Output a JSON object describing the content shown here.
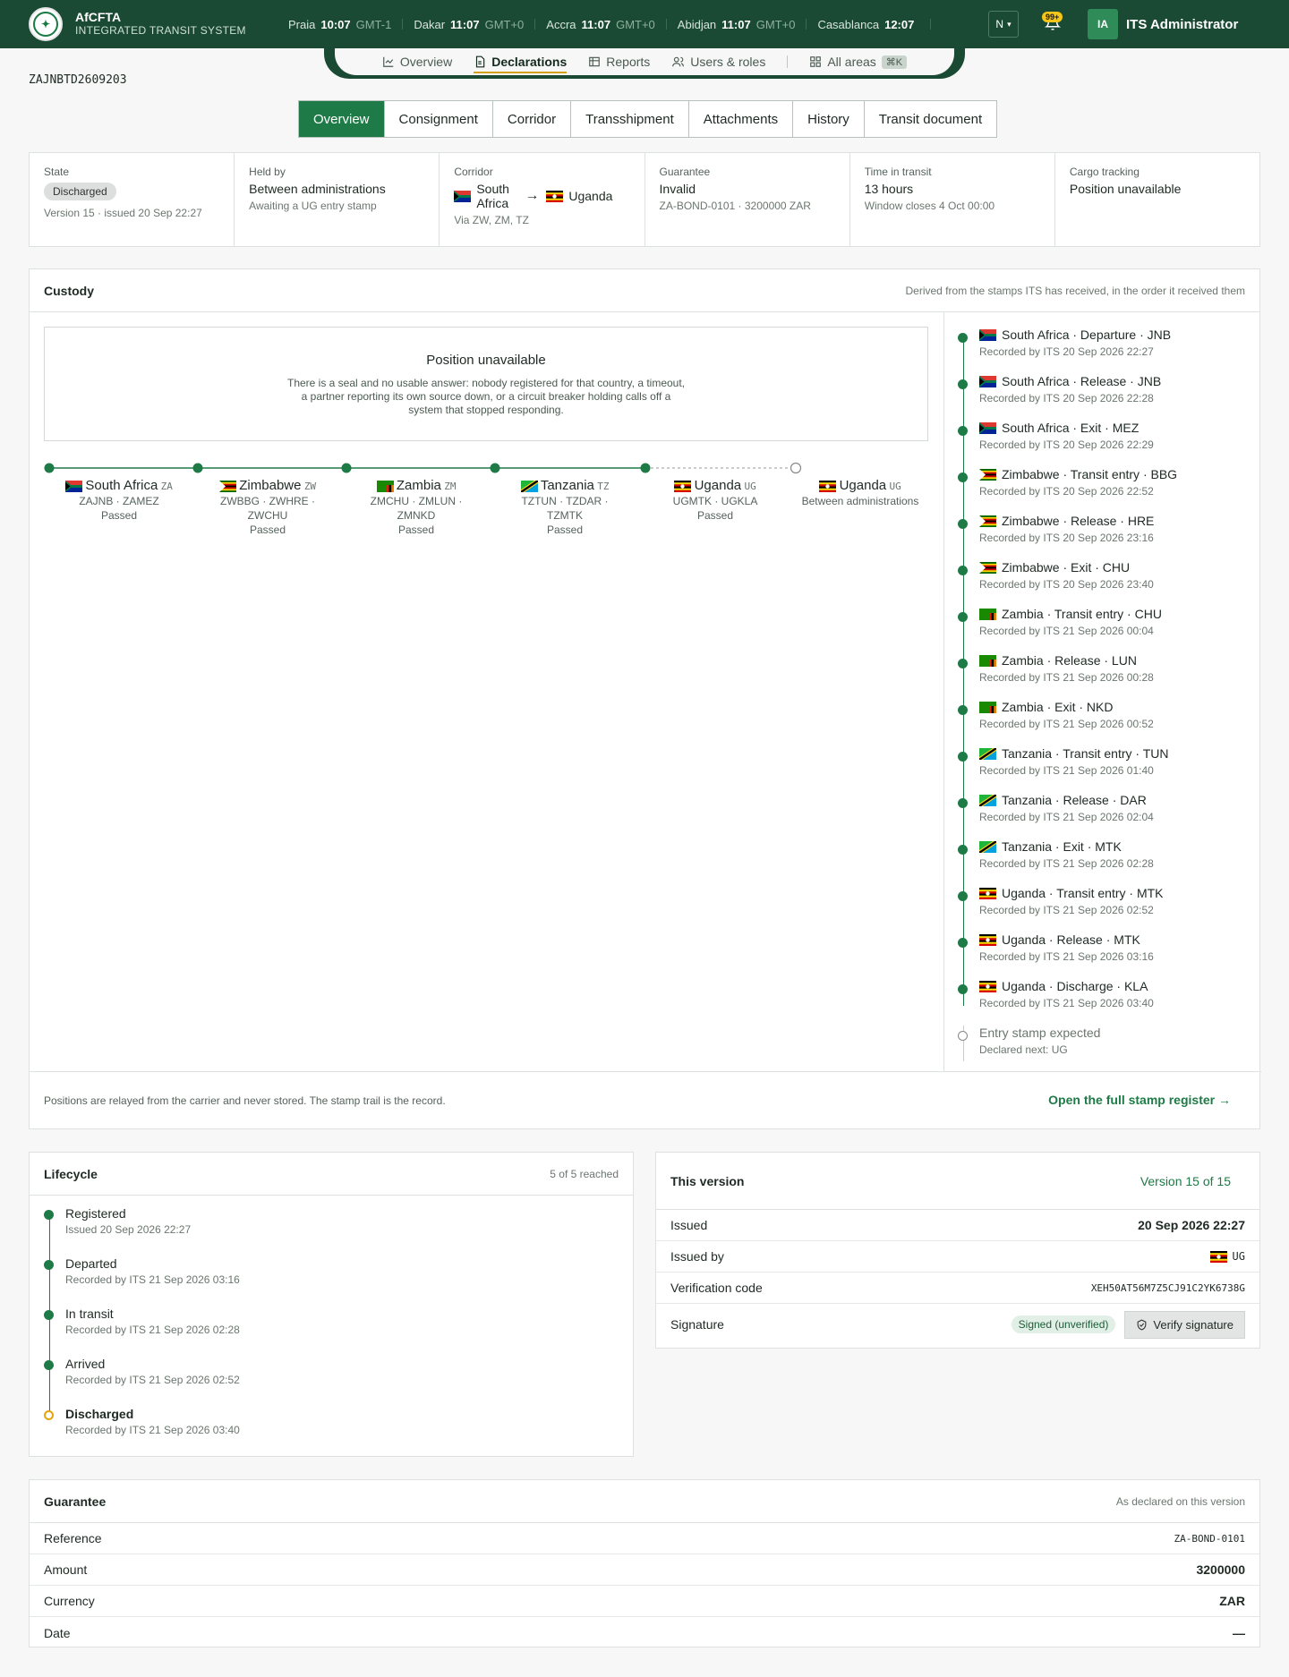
{
  "header": {
    "brand_name": "AfCFTA",
    "brand_sub": "INTEGRATED TRANSIT SYSTEM",
    "clocks": [
      {
        "city": "Praia",
        "time": "10:07",
        "gmt": "GMT-1"
      },
      {
        "city": "Dakar",
        "time": "11:07",
        "gmt": "GMT+0"
      },
      {
        "city": "Accra",
        "time": "11:07",
        "gmt": "GMT+0"
      },
      {
        "city": "Abidjan",
        "time": "11:07",
        "gmt": "GMT+0"
      },
      {
        "city": "Casablanca",
        "time": "12:07",
        "gmt": ""
      }
    ],
    "lang": "N",
    "notifications": "99+",
    "avatar_initials": "IA",
    "user_name": "ITS Administrator"
  },
  "nav": {
    "overview": "Overview",
    "declarations": "Declarations",
    "reports": "Reports",
    "users": "Users & roles",
    "all_areas": "All areas",
    "shortcut": "⌘K"
  },
  "reference": "ZAJNBTD2609203",
  "tabs": [
    "Overview",
    "Consignment",
    "Corridor",
    "Transshipment",
    "Attachments",
    "History",
    "Transit document"
  ],
  "summary": {
    "state_label": "State",
    "state": "Discharged",
    "state_sub": "Version 15 · issued 20 Sep 22:27",
    "held_label": "Held by",
    "held": "Between administrations",
    "held_sub": "Awaiting a UG entry stamp",
    "corridor_label": "Corridor",
    "corridor_from": "South Africa",
    "corridor_to": "Uganda",
    "corridor_sub": "Via ZW, ZM, TZ",
    "guarantee_label": "Guarantee",
    "guarantee": "Invalid",
    "guarantee_sub": "ZA-BOND-0101 · 3200000 ZAR",
    "time_label": "Time in transit",
    "time": "13 hours",
    "time_sub": "Window closes 4 Oct 00:00",
    "cargo_label": "Cargo tracking",
    "cargo": "Position unavailable"
  },
  "custody": {
    "title": "Custody",
    "note": "Derived from the stamps ITS has received, in the order it received them",
    "pos_title": "Position unavailable",
    "pos_desc": "There is a seal and no usable answer: nobody registered for that country, a timeout, a partner reporting its own source down, or a circuit breaker holding calls off a system that stopped responding.",
    "stops": [
      {
        "name": "South Africa",
        "code": "ZA",
        "offices": "ZAJNB · ZAMEZ",
        "status": "Passed"
      },
      {
        "name": "Zimbabwe",
        "code": "ZW",
        "offices": "ZWBBG · ZWHRE · ZWCHU",
        "status": "Passed"
      },
      {
        "name": "Zambia",
        "code": "ZM",
        "offices": "ZMCHU · ZMLUN · ZMNKD",
        "status": "Passed"
      },
      {
        "name": "Tanzania",
        "code": "TZ",
        "offices": "TZTUN · TZDAR · TZMTK",
        "status": "Passed"
      },
      {
        "name": "Uganda",
        "code": "UG",
        "offices": "UGMTK · UGKLA",
        "status": "Passed"
      },
      {
        "name": "Uganda",
        "code": "UG",
        "offices": "",
        "status": "Between administrations"
      }
    ],
    "trail": [
      {
        "title": "South Africa · Departure · JNB",
        "sub": "Recorded by ITS 20 Sep 2026 22:27",
        "flag": "za"
      },
      {
        "title": "South Africa · Release · JNB",
        "sub": "Recorded by ITS 20 Sep 2026 22:28",
        "flag": "za"
      },
      {
        "title": "South Africa · Exit · MEZ",
        "sub": "Recorded by ITS 20 Sep 2026 22:29",
        "flag": "za"
      },
      {
        "title": "Zimbabwe · Transit entry · BBG",
        "sub": "Recorded by ITS 20 Sep 2026 22:52",
        "flag": "zw"
      },
      {
        "title": "Zimbabwe · Release · HRE",
        "sub": "Recorded by ITS 20 Sep 2026 23:16",
        "flag": "zw"
      },
      {
        "title": "Zimbabwe · Exit · CHU",
        "sub": "Recorded by ITS 20 Sep 2026 23:40",
        "flag": "zw"
      },
      {
        "title": "Zambia · Transit entry · CHU",
        "sub": "Recorded by ITS 21 Sep 2026 00:04",
        "flag": "zm"
      },
      {
        "title": "Zambia · Release · LUN",
        "sub": "Recorded by ITS 21 Sep 2026 00:28",
        "flag": "zm"
      },
      {
        "title": "Zambia · Exit · NKD",
        "sub": "Recorded by ITS 21 Sep 2026 00:52",
        "flag": "zm"
      },
      {
        "title": "Tanzania · Transit entry · TUN",
        "sub": "Recorded by ITS 21 Sep 2026 01:40",
        "flag": "tz"
      },
      {
        "title": "Tanzania · Release · DAR",
        "sub": "Recorded by ITS 21 Sep 2026 02:04",
        "flag": "tz"
      },
      {
        "title": "Tanzania · Exit · MTK",
        "sub": "Recorded by ITS 21 Sep 2026 02:28",
        "flag": "tz"
      },
      {
        "title": "Uganda · Transit entry · MTK",
        "sub": "Recorded by ITS 21 Sep 2026 02:52",
        "flag": "ug"
      },
      {
        "title": "Uganda · Release · MTK",
        "sub": "Recorded by ITS 21 Sep 2026 03:16",
        "flag": "ug"
      },
      {
        "title": "Uganda · Discharge · KLA",
        "sub": "Recorded by ITS 21 Sep 2026 03:40",
        "flag": "ug"
      },
      {
        "title": "Entry stamp expected",
        "sub": "Declared next: UG",
        "flag": ""
      }
    ],
    "footer_note": "Positions are relayed from the carrier and never stored. The stamp trail is the record.",
    "register_link": "Open the full stamp register →"
  },
  "lifecycle": {
    "title": "Lifecycle",
    "count": "5 of 5 reached",
    "steps": [
      {
        "title": "Registered",
        "sub": "Issued 20 Sep 2026 22:27"
      },
      {
        "title": "Departed",
        "sub": "Recorded by ITS 21 Sep 2026 03:16"
      },
      {
        "title": "In transit",
        "sub": "Recorded by ITS 21 Sep 2026 02:28"
      },
      {
        "title": "Arrived",
        "sub": "Recorded by ITS 21 Sep 2026 02:52"
      },
      {
        "title": "Discharged",
        "sub": "Recorded by ITS 21 Sep 2026 03:40"
      }
    ]
  },
  "version": {
    "title": "This version",
    "version": "Version 15 of 15",
    "issued_label": "Issued",
    "issued": "20 Sep 2026 22:27",
    "issued_by_label": "Issued by",
    "issued_by": "UG",
    "code_label": "Verification code",
    "code": "XEH50AT56M7Z5CJ91C2YK6738G",
    "signature_label": "Signature",
    "signature_status": "Signed (unverified)",
    "verify_button": "Verify signature"
  },
  "guarantee": {
    "title": "Guarantee",
    "note": "As declared on this version",
    "reference_label": "Reference",
    "reference": "ZA-BOND-0101",
    "amount_label": "Amount",
    "amount": "3200000",
    "currency_label": "Currency",
    "currency": "ZAR",
    "date_label": "Date",
    "date": "—"
  },
  "colors": {
    "header": "#1a4a33",
    "accent": "#1e7a46",
    "active_underline": "#d4a017"
  }
}
